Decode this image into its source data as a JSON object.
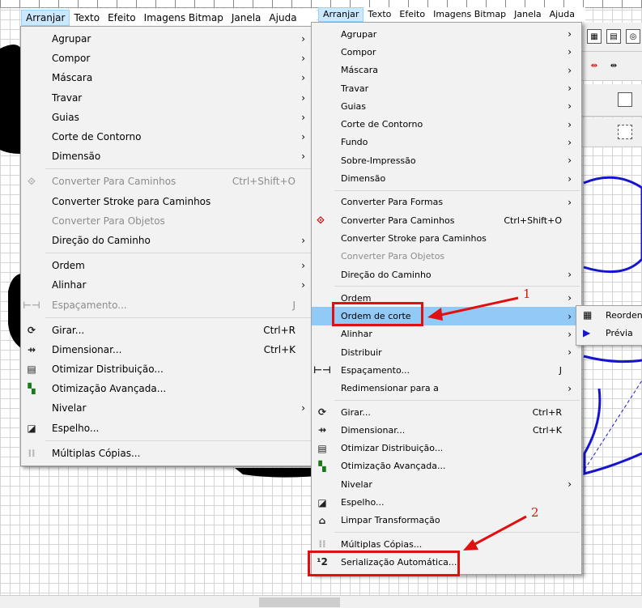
{
  "menubar": {
    "items": [
      "Arranjar",
      "Texto",
      "Efeito",
      "Imagens Bitmap",
      "Janela",
      "Ajuda"
    ]
  },
  "left_menu": {
    "items": [
      {
        "label": "Agrupar",
        "submenu": true
      },
      {
        "label": "Compor",
        "submenu": true
      },
      {
        "label": "Máscara",
        "submenu": true
      },
      {
        "label": "Travar",
        "submenu": true
      },
      {
        "label": "Guias",
        "submenu": true
      },
      {
        "label": "Corte de Contorno",
        "submenu": true
      },
      {
        "label": "Dimensão",
        "submenu": true
      },
      {
        "label": "Converter Para Caminhos",
        "shortcut": "Ctrl+Shift+O",
        "disabled": true
      },
      {
        "label": "Converter Stroke para Caminhos"
      },
      {
        "label": "Converter Para Objetos",
        "disabled": true
      },
      {
        "label": "Direção do Caminho",
        "submenu": true
      },
      {
        "label": "Ordem",
        "submenu": true
      },
      {
        "label": "Alinhar",
        "submenu": true
      },
      {
        "label": "Espaçamento...",
        "shortcut": "J",
        "disabled": true
      },
      {
        "label": "Girar...",
        "shortcut": "Ctrl+R"
      },
      {
        "label": "Dimensionar...",
        "shortcut": "Ctrl+K"
      },
      {
        "label": "Otimizar Distribuição..."
      },
      {
        "label": "Otimização Avançada..."
      },
      {
        "label": "Nivelar",
        "submenu": true
      },
      {
        "label": "Espelho..."
      },
      {
        "label": "Múltiplas Cópias..."
      }
    ]
  },
  "right_menu": {
    "items": [
      {
        "label": "Agrupar",
        "submenu": true
      },
      {
        "label": "Compor",
        "submenu": true
      },
      {
        "label": "Máscara",
        "submenu": true
      },
      {
        "label": "Travar",
        "submenu": true
      },
      {
        "label": "Guias",
        "submenu": true
      },
      {
        "label": "Corte de Contorno",
        "submenu": true
      },
      {
        "label": "Fundo",
        "submenu": true
      },
      {
        "label": "Sobre-Impressão",
        "submenu": true
      },
      {
        "label": "Dimensão",
        "submenu": true
      },
      {
        "label": "Converter Para Formas",
        "submenu": true
      },
      {
        "label": "Converter Para Caminhos",
        "shortcut": "Ctrl+Shift+O"
      },
      {
        "label": "Converter Stroke para Caminhos"
      },
      {
        "label": "Converter Para Objetos",
        "disabled": true
      },
      {
        "label": "Direção do Caminho",
        "submenu": true
      },
      {
        "label": "Ordem",
        "submenu": true
      },
      {
        "label": "Ordem de corte",
        "submenu": true
      },
      {
        "label": "Alinhar",
        "submenu": true
      },
      {
        "label": "Distribuir",
        "submenu": true
      },
      {
        "label": "Espaçamento...",
        "shortcut": "J"
      },
      {
        "label": "Redimensionar para a",
        "submenu": true
      },
      {
        "label": "Girar...",
        "shortcut": "Ctrl+R"
      },
      {
        "label": "Dimensionar...",
        "shortcut": "Ctrl+K"
      },
      {
        "label": "Otimizar Distribuição..."
      },
      {
        "label": "Otimização Avançada..."
      },
      {
        "label": "Nivelar",
        "submenu": true
      },
      {
        "label": "Espelho..."
      },
      {
        "label": "Limpar Transformação"
      },
      {
        "label": "Múltiplas Cópias..."
      },
      {
        "label": "Serialização Automática..."
      }
    ]
  },
  "submenu": {
    "items": [
      "Reorden",
      "Prévia"
    ]
  },
  "annotations": {
    "label_1": "1",
    "label_2": "2",
    "color": "#e01010"
  },
  "colors": {
    "menu_bg": "#f2f2f2",
    "highlight": "#91c9f7",
    "active_menubar": "#cce8ff",
    "canvas_shape": "#1515d0"
  }
}
